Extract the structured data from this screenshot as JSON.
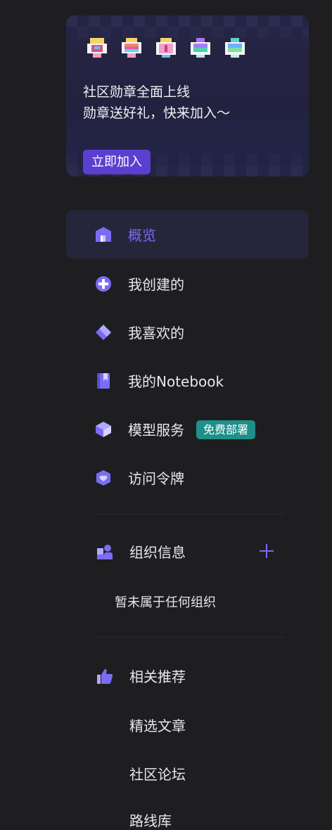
{
  "banner": {
    "line1": "社区勋章全面上线",
    "line2": "勋章送好礼，快来加入～",
    "button": "立即加入"
  },
  "nav": {
    "items": [
      {
        "label": "概览",
        "icon": "home-icon",
        "active": true
      },
      {
        "label": "我创建的",
        "icon": "plus-circle-icon"
      },
      {
        "label": "我喜欢的",
        "icon": "diamond-icon"
      },
      {
        "label": "我的Notebook",
        "icon": "notebook-icon"
      },
      {
        "label": "模型服务",
        "icon": "cube-icon",
        "tag": "免费部署"
      },
      {
        "label": "访问令牌",
        "icon": "token-icon"
      }
    ]
  },
  "org": {
    "title": "组织信息",
    "empty": "暂未属于任何组织"
  },
  "recommend": {
    "title": "相关推荐",
    "links": [
      "精选文章",
      "社区论坛",
      "路线库"
    ]
  },
  "colors": {
    "accent": "#7b6cf6",
    "button": "#5b3fd0",
    "tag": "#1f8f8a",
    "background": "#1e1e20"
  }
}
